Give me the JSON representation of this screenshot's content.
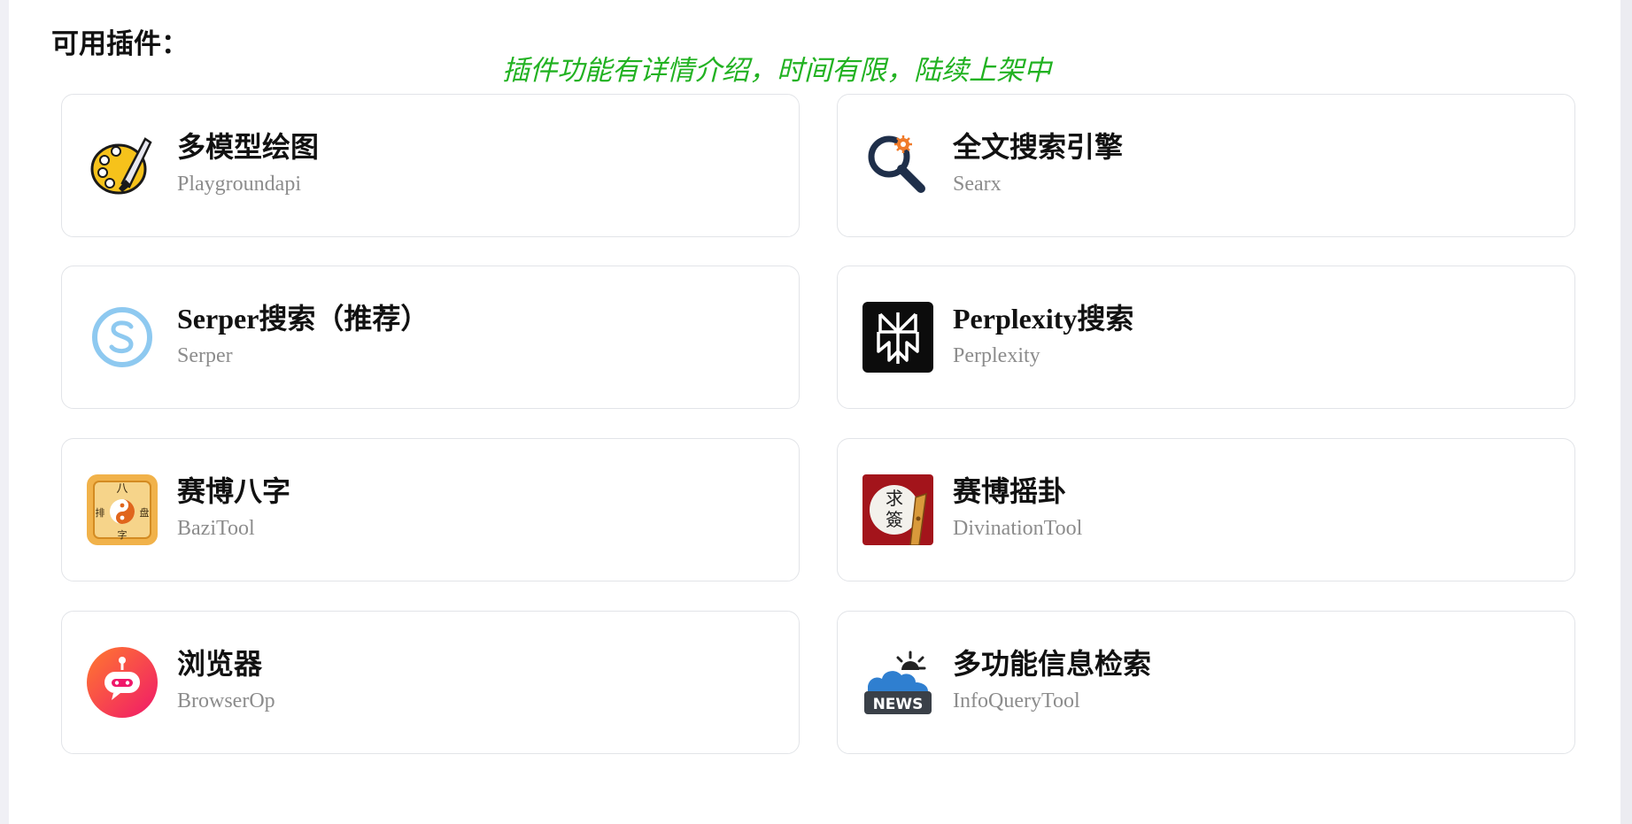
{
  "section": {
    "title": "可用插件："
  },
  "notice": "插件功能有详情介绍，时间有限，陆续上架中",
  "plugins": [
    {
      "name": "多模型绘图",
      "id": "Playgroundapi",
      "icon": "palette-icon"
    },
    {
      "name": "全文搜索引擎",
      "id": "Searx",
      "icon": "search-gear-icon"
    },
    {
      "name": "Serper搜索（推荐）",
      "id": "Serper",
      "icon": "serper-icon"
    },
    {
      "name": "Perplexity搜索",
      "id": "Perplexity",
      "icon": "perplexity-icon"
    },
    {
      "name": "赛博八字",
      "id": "BaziTool",
      "icon": "bazi-icon",
      "icon_text": [
        "八",
        "排",
        "盘",
        "字"
      ]
    },
    {
      "name": "赛博摇卦",
      "id": "DivinationTool",
      "icon": "divination-icon",
      "icon_text": [
        "求",
        "簽"
      ]
    },
    {
      "name": "浏览器",
      "id": "BrowserOp",
      "icon": "robot-icon"
    },
    {
      "name": "多功能信息检索",
      "id": "InfoQueryTool",
      "icon": "news-weather-icon",
      "icon_text": [
        "NEWS"
      ]
    }
  ],
  "colors": {
    "notice": "#22b222",
    "card_border": "#e2e4e8",
    "subtitle": "#8c8c8c"
  }
}
